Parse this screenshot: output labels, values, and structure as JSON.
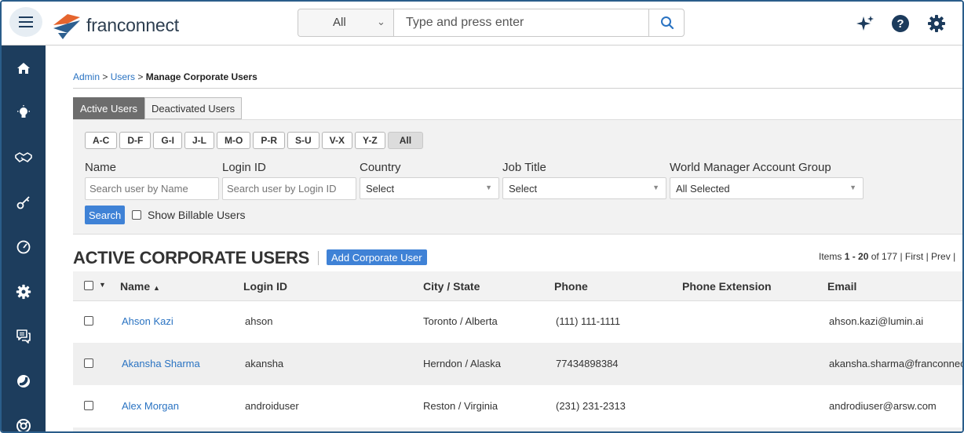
{
  "header": {
    "logo_text": "franconnect",
    "search": {
      "category": "All",
      "placeholder": "Type and press enter"
    }
  },
  "breadcrumb": {
    "admin": "Admin",
    "sep1": ">",
    "users": "Users",
    "sep2": ">",
    "current": "Manage Corporate Users"
  },
  "tabs": {
    "active": "Active Users",
    "deactivated": "Deactivated Users"
  },
  "filters": {
    "alpha": [
      "A-C",
      "D-F",
      "G-I",
      "J-L",
      "M-O",
      "P-R",
      "S-U",
      "V-X",
      "Y-Z",
      "All"
    ],
    "name_label": "Name",
    "name_placeholder": "Search user by Name",
    "login_label": "Login ID",
    "login_placeholder": "Search user by Login ID",
    "country_label": "Country",
    "country_value": "Select",
    "job_label": "Job Title",
    "job_value": "Select",
    "wm_label": "World Manager Account Group",
    "wm_value": "All Selected",
    "search_button": "Search",
    "billable_label": "Show Billable Users"
  },
  "section": {
    "title": "ACTIVE CORPORATE USERS",
    "add_button": "Add Corporate User",
    "pagination": {
      "prefix": "Items",
      "range": "1 - 20",
      "of": "of 177",
      "first": "First",
      "prev": "Prev",
      "sep": "|"
    }
  },
  "table": {
    "columns": {
      "name": "Name",
      "sort_arrow": "▲",
      "login": "Login ID",
      "city": "City / State",
      "phone": "Phone",
      "ext": "Phone Extension",
      "email": "Email"
    },
    "rows": [
      {
        "name": "Ahson Kazi",
        "login": "ahson",
        "city": "Toronto / Alberta",
        "phone": "(111) 111-1111",
        "ext": "",
        "email": "ahson.kazi@lumin.ai"
      },
      {
        "name": "Akansha Sharma",
        "login": "akansha",
        "city": "Herndon / Alaska",
        "phone": "77434898384",
        "ext": "",
        "email": "akansha.sharma@franconnect"
      },
      {
        "name": "Alex Morgan",
        "login": "androiduser",
        "city": "Reston / Virginia",
        "phone": "(231) 231-2313",
        "ext": "",
        "email": "androdiuser@arsw.com"
      }
    ]
  },
  "icons": {
    "sidebar": [
      "home-icon",
      "lightbulb-icon",
      "handshake-icon",
      "key-icon",
      "gauge-icon",
      "gear-icon",
      "chat-icon",
      "moon-icon",
      "lifebuoy-icon"
    ],
    "top": [
      "sparkle-icon",
      "help-icon",
      "settings-icon"
    ]
  },
  "colors": {
    "sidebar": "#1d3d5d",
    "link": "#2a73c2",
    "button": "#3f82d6"
  }
}
